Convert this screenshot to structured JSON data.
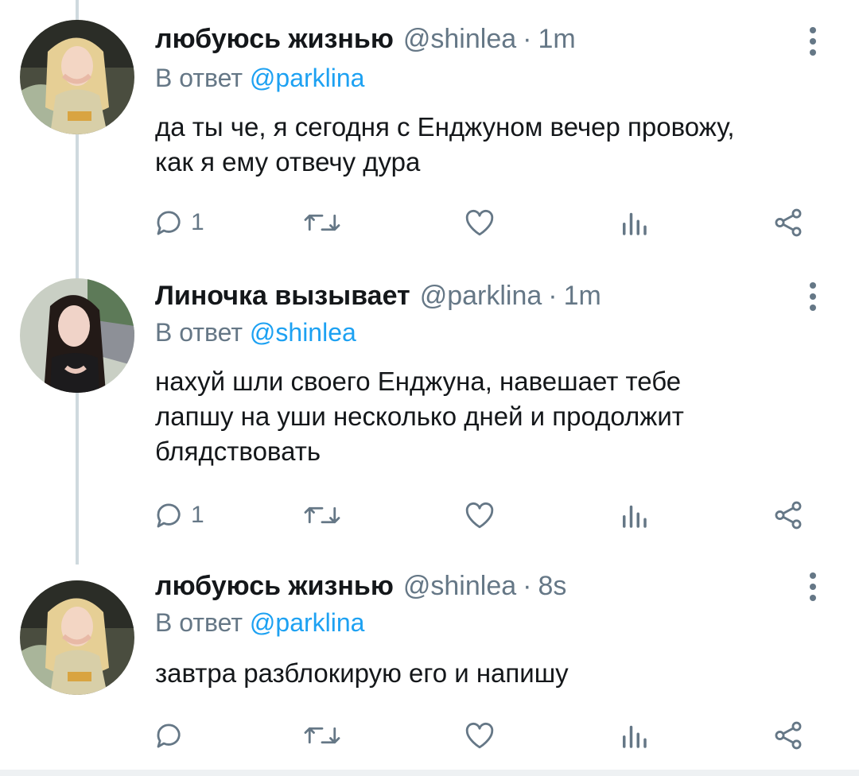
{
  "tweets": [
    {
      "display_name": "любуюсь жизнью",
      "handle": "@shinlea",
      "dot": "·",
      "time": "1m",
      "reply_prefix": "В ответ",
      "reply_mention": "@parklina",
      "body_lines": [
        "да ты че, я сегодня с Енджуном вечер провожу,",
        "как я ему отвечу дура"
      ],
      "reply_count": "1",
      "avatar": "blonde-girl-avatar"
    },
    {
      "display_name": "Линочка вызывает",
      "handle": "@parklina",
      "dot": "·",
      "time": "1m",
      "reply_prefix": "В ответ",
      "reply_mention": "@shinlea",
      "body_lines": [
        "нахуй шли своего Енджуна, навешает тебе",
        "лапшу на уши несколько дней и продолжит",
        "блядствовать"
      ],
      "reply_count": "1",
      "avatar": "dark-haired-girl-avatar"
    },
    {
      "display_name": "любуюсь жизнью",
      "handle": "@shinlea",
      "dot": "·",
      "time": "8s",
      "reply_prefix": "В ответ",
      "reply_mention": "@parklina",
      "body_lines": [
        "завтра разблокирую его и напишу"
      ],
      "reply_count": "",
      "avatar": "blonde-girl-avatar"
    }
  ],
  "icons": {
    "reply": "reply-icon",
    "retweet": "retweet-icon",
    "like": "heart-icon",
    "stats": "analytics-icon",
    "share": "share-icon",
    "menu": "more-vertical-icon"
  },
  "colors": {
    "text": "#14171a",
    "secondary": "#657786",
    "mention": "#1da1f2",
    "thread_line": "#cfd9de"
  }
}
